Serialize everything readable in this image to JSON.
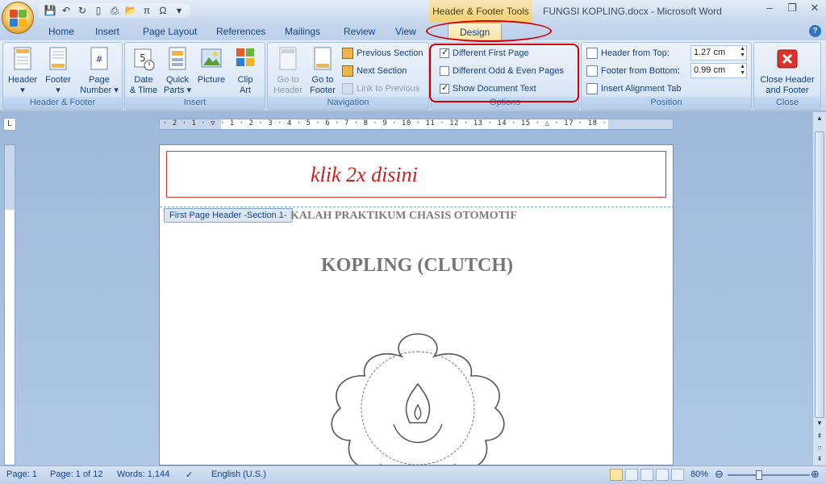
{
  "window": {
    "contextual_tab": "Header & Footer Tools",
    "title": "FUNGSI KOPLING.docx - Microsoft Word",
    "controls": [
      "–",
      "❐",
      "✕"
    ]
  },
  "qat": {
    "undo": "↶",
    "redo": "↻",
    "pi": "π",
    "omega": "Ω"
  },
  "tabs": [
    {
      "label": "Home"
    },
    {
      "label": "Insert"
    },
    {
      "label": "Page Layout"
    },
    {
      "label": "References"
    },
    {
      "label": "Mailings"
    },
    {
      "label": "Review"
    },
    {
      "label": "View"
    },
    {
      "label": "Design"
    }
  ],
  "ribbon": {
    "groups": {
      "header_footer": "Header & Footer",
      "insert": "Insert",
      "navigation": "Navigation",
      "options": "Options",
      "position": "Position",
      "close": "Close"
    },
    "header_btn": "Header",
    "footer_btn": "Footer",
    "page_number_btn": [
      "Page",
      "Number"
    ],
    "date_time_btn": [
      "Date",
      "& Time"
    ],
    "quick_parts_btn": [
      "Quick",
      "Parts"
    ],
    "picture_btn": "Picture",
    "clip_art_btn": [
      "Clip",
      "Art"
    ],
    "goto_header_btn": [
      "Go to",
      "Header"
    ],
    "goto_footer_btn": [
      "Go to",
      "Footer"
    ],
    "previous_section": "Previous Section",
    "next_section": "Next Section",
    "link_to_previous": "Link to Previous",
    "different_first_page": "Different First Page",
    "different_odd_even": "Different Odd & Even Pages",
    "show_document_text": "Show Document Text",
    "header_from_top_label": "Header from Top:",
    "header_from_top_value": "1.27 cm",
    "footer_from_bottom_label": "Footer from Bottom:",
    "footer_from_bottom_value": "0.99 cm",
    "insert_alignment_tab": "Insert Alignment Tab",
    "close_btn": [
      "Close Header",
      "and Footer"
    ]
  },
  "options_state": {
    "different_first_page": true,
    "different_odd_even": false,
    "show_document_text": true
  },
  "ruler": {
    "corner": "L",
    "ticks": "· 2 · 1 · ▽ · 1 · 2 · 3 · 4 · 5 · 6 · 7 · 8 · 9 · 10 · 11 · 12 · 13 · 14 · 15 · △ · 17 · 18 ·"
  },
  "document": {
    "header_note": "klik 2x disini",
    "header_tag": "First Page Header -Section 1-",
    "subtitle": "KALAH PRAKTIKUM CHASIS OTOMOTIF",
    "heading": "KOPLING (CLUTCH)"
  },
  "status": {
    "page": "Page: 1",
    "page_of": "Page: 1 of 12",
    "words": "Words: 1,144",
    "language": "English (U.S.)",
    "zoom": "80%",
    "minus": "⊖",
    "plus": "⊕"
  }
}
